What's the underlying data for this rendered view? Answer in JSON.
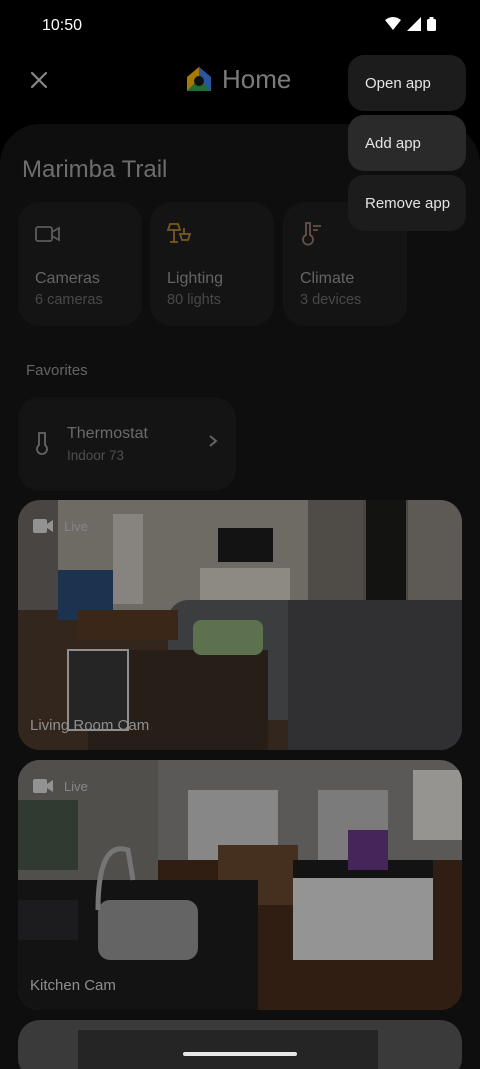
{
  "status": {
    "time": "10:50"
  },
  "header": {
    "title": "Home"
  },
  "home": {
    "title": "Marimba Trail"
  },
  "tiles": [
    {
      "label": "Cameras",
      "sub": "6 cameras",
      "icon": "camera-icon"
    },
    {
      "label": "Lighting",
      "sub": "80 lights",
      "icon": "lighting-icon"
    },
    {
      "label": "Climate",
      "sub": "3 devices",
      "icon": "thermometer-icon"
    }
  ],
  "favorites": {
    "label": "Favorites",
    "thermostat": {
      "title": "Thermostat",
      "sub": "Indoor 73"
    }
  },
  "cameras": [
    {
      "live": "Live",
      "name": "Living Room Cam"
    },
    {
      "live": "Live",
      "name": "Kitchen Cam"
    }
  ],
  "menu": {
    "items": [
      "Open app",
      "Add app",
      "Remove app"
    ],
    "highlighted_index": 1
  },
  "colors": {
    "logo": [
      "#ea4335",
      "#fbbc05",
      "#34a853",
      "#4285f4"
    ]
  }
}
